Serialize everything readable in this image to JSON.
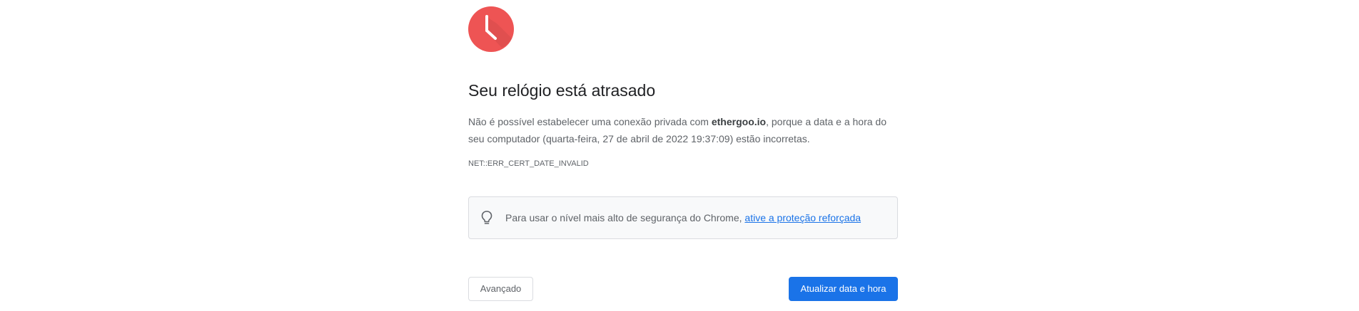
{
  "interstitial": {
    "icon": "clock-icon",
    "icon_color": "#ee5454",
    "title": "Seu relógio está atrasado",
    "body": {
      "prefix": "Não é possível estabelecer uma conexão privada com ",
      "domain": "ethergoo.io",
      "suffix": ", porque a data e a hora do seu computador (quarta-feira, 27 de abril de 2022 19:37:09) estão incorretas."
    },
    "error_code": "NET::ERR_CERT_DATE_INVALID"
  },
  "enhanced_protection": {
    "icon": "lightbulb-icon",
    "text": "Para usar o nível mais alto de segurança do Chrome, ",
    "link_label": "ative a proteção reforçada"
  },
  "buttons": {
    "advanced_label": "Avançado",
    "update_label": "Atualizar data e hora"
  },
  "colors": {
    "accent": "#1a73e8",
    "text_secondary": "#5f6368",
    "border": "#dadce0"
  }
}
